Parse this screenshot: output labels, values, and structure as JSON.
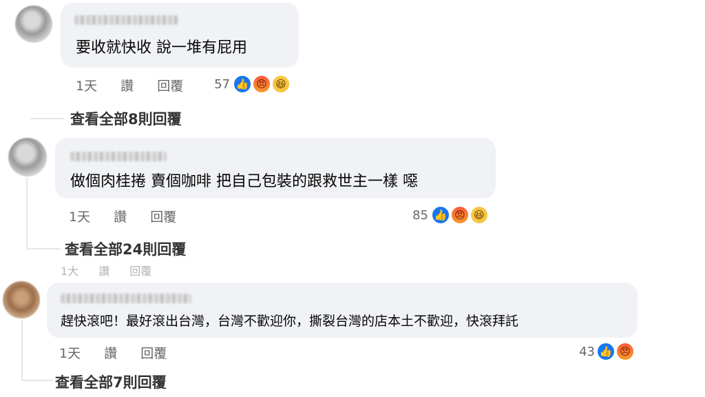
{
  "comments": [
    {
      "text": "要收就快收 說一堆有屁用",
      "time": "1天",
      "like": "讚",
      "reply": "回覆",
      "reaction_count": "57",
      "reactions": [
        "like-icon",
        "angry-icon",
        "haha-icon"
      ],
      "view_replies": "查看全部8則回覆"
    },
    {
      "text": "做個肉桂捲 賣個咖啡 把自己包裝的跟救世主一樣 噁",
      "time": "1天",
      "like": "讚",
      "reply": "回覆",
      "reaction_count": "85",
      "reactions": [
        "like-icon",
        "angry-icon",
        "haha-icon"
      ],
      "view_replies": "查看全部24則回覆",
      "ghost_meta": {
        "time": "1大",
        "like": "讚",
        "reply": "回覆"
      }
    },
    {
      "text": "趕快滾吧！最好滾出台灣，台灣不歡迎你，撕裂台灣的店本土不歡迎，快滾拜託",
      "time": "1天",
      "like": "讚",
      "reply": "回覆",
      "reaction_count": "43",
      "reactions": [
        "like-icon",
        "angry-icon"
      ],
      "view_replies": "查看全部7則回覆"
    }
  ],
  "colors": {
    "bubble": "#f0f2f5",
    "like": "#1877f2",
    "meta": "#65676b"
  }
}
